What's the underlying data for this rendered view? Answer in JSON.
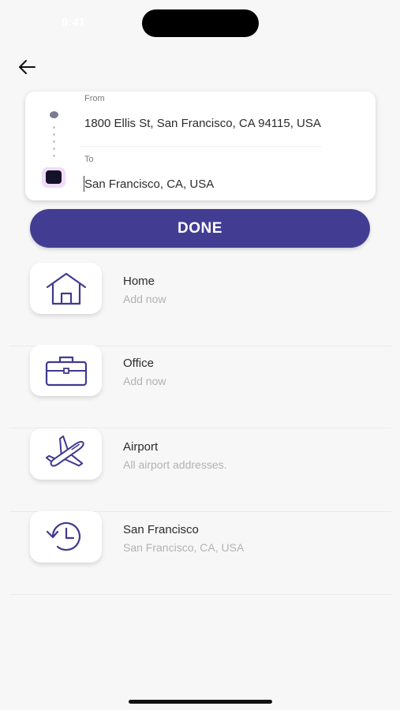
{
  "status_bar": {
    "time": "9:41",
    "right": ""
  },
  "route": {
    "from_label": "From",
    "from_value": "1800 Ellis St, San Francisco, CA 94115, USA",
    "to_label": "To",
    "to_value": "San Francisco, CA, USA"
  },
  "done_label": "DONE",
  "places": [
    {
      "title": "Home",
      "subtitle": "Add now",
      "icon": "home-icon"
    },
    {
      "title": "Office",
      "subtitle": "Add now",
      "icon": "briefcase-icon"
    },
    {
      "title": "Airport",
      "subtitle": "All airport addresses.",
      "icon": "airplane-icon"
    },
    {
      "title": "San Francisco",
      "subtitle": "San Francisco, CA, USA",
      "icon": "history-clock-icon"
    }
  ],
  "colors": {
    "accent": "#423d93",
    "icon_stroke": "#3f3a8f",
    "to_marker": "#14112b",
    "to_marker_halo": "#f0dcf7"
  }
}
